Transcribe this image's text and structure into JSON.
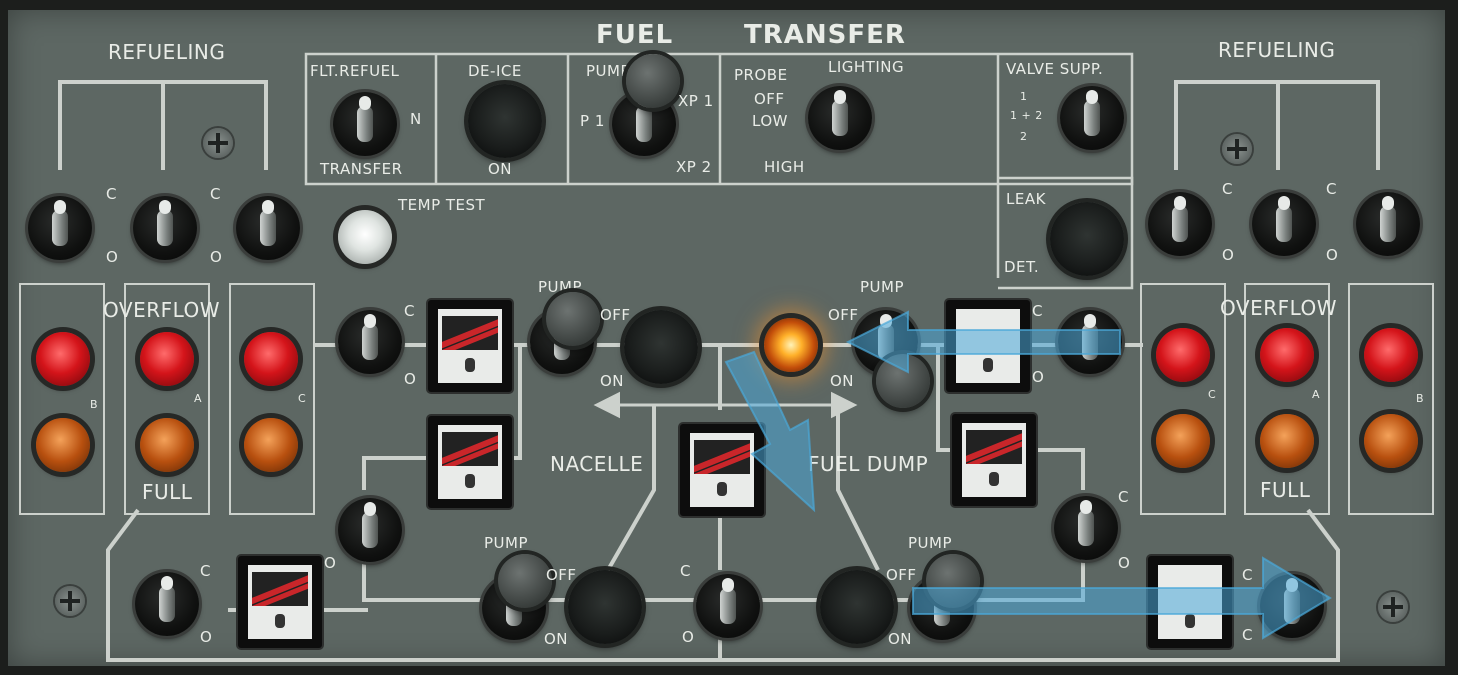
{
  "title": {
    "left": "FUEL",
    "right": "TRANSFER"
  },
  "labels": {
    "refueling_left": "REFUELING",
    "refueling_right": "REFUELING",
    "flt_refuel": "FLT.REFUEL",
    "n": "N",
    "transfer": "TRANSFER",
    "de_ice": "DE-ICE",
    "on": "ON",
    "pump_supp": "PUMP SUPP.",
    "p1": "P 1",
    "xp1": "XP 1",
    "xp2": "XP 2",
    "probe": "PROBE",
    "lighting": "LIGHTING",
    "off": "OFF",
    "low": "LOW",
    "high": "HIGH",
    "valve_supp": "VALVE SUPP.",
    "v1": "1",
    "v12": "1 + 2",
    "v2": "2",
    "leak": "LEAK",
    "det": "DET.",
    "temp_test": "TEMP TEST",
    "overflow_left": "OVERFLOW",
    "overflow_right": "OVERFLOW",
    "full_left": "FULL",
    "full_right": "FULL",
    "pump": "PUMP",
    "pump_off": "OFF",
    "pump_on": "ON",
    "nacelle": "NACELLE",
    "fuel_dump": "FUEL DUMP",
    "c": "C",
    "o": "O",
    "b": "B",
    "a": "A"
  },
  "colors": {
    "panel": "#5d6763",
    "text": "#e9ece7",
    "lamp_red": "#d4141a",
    "lamp_amber": "#b8500f",
    "lamp_lit": "#ffb12a",
    "hint_arrow": "#4aa8d8"
  },
  "icons": {
    "screw": "screw-icon",
    "arrow": "hint-arrow-icon"
  }
}
